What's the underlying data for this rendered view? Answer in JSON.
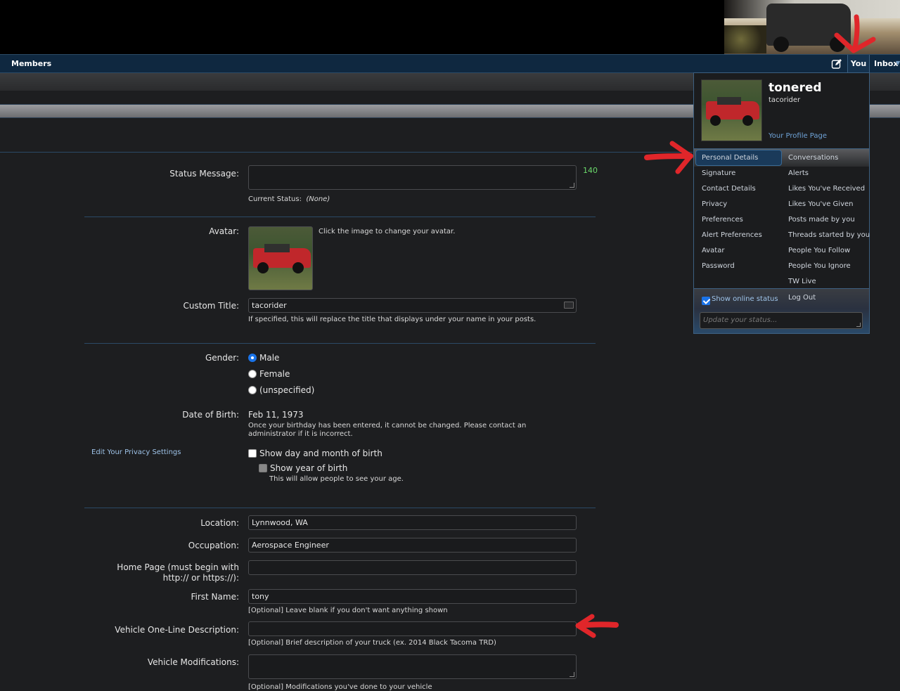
{
  "nav": {
    "members": "Members",
    "you": "You",
    "inbox": "Inbox"
  },
  "form": {
    "status_message_label": "Status Message:",
    "status_counter": "140",
    "current_status_label": "Current Status:",
    "current_status_value": "(None)",
    "avatar_label": "Avatar:",
    "avatar_hint": "Click the image to change your avatar.",
    "custom_title_label": "Custom Title:",
    "custom_title_value": "tacorider",
    "custom_title_hint": "If specified, this will replace the title that displays under your name in your posts.",
    "gender_label": "Gender:",
    "gender_options": [
      "Male",
      "Female",
      "(unspecified)"
    ],
    "gender_selected": "Male",
    "dob_label": "Date of Birth:",
    "dob_value": "Feb 11, 1973",
    "dob_hint": "Once your birthday has been entered, it cannot be changed. Please contact an administrator if it is incorrect.",
    "privacy_link": "Edit Your Privacy Settings",
    "show_day_month": "Show day and month of birth",
    "show_year": "Show year of birth",
    "show_year_hint": "This will allow people to see your age.",
    "location_label": "Location:",
    "location_value": "Lynnwood, WA",
    "occupation_label": "Occupation:",
    "occupation_value": "Aerospace Engineer",
    "homepage_label": "Home Page (must begin with http:// or https://):",
    "homepage_value": "",
    "first_name_label": "First Name:",
    "first_name_value": "tony",
    "first_name_hint": "[Optional] Leave blank if you don't want anything shown",
    "vehicle_desc_label": "Vehicle One-Line Description:",
    "vehicle_desc_value": "",
    "vehicle_desc_hint": "[Optional] Brief description of your truck (ex. 2014 Black Tacoma TRD)",
    "vehicle_mods_label": "Vehicle Modifications:",
    "vehicle_mods_hint": "[Optional] Modifications you've done to your vehicle"
  },
  "user_menu": {
    "username": "tonered",
    "user_title": "tacorider",
    "profile_link": "Your Profile Page",
    "left_items": [
      "Personal Details",
      "Signature",
      "Contact Details",
      "Privacy",
      "Preferences",
      "Alert Preferences",
      "Avatar",
      "Password"
    ],
    "right_items": [
      "Conversations",
      "Alerts",
      "Likes You've Received",
      "Likes You've Given",
      "Posts made by you",
      "Threads started by you",
      "People You Follow",
      "People You Ignore",
      "TW Live"
    ],
    "show_online_status": "Show online status",
    "log_out": "Log Out",
    "status_placeholder": "Update your status..."
  },
  "colors": {
    "nav_bg": "#0f2840",
    "link": "#6fa3d8",
    "counter": "#6bd96b",
    "annotation": "#e0262a"
  }
}
